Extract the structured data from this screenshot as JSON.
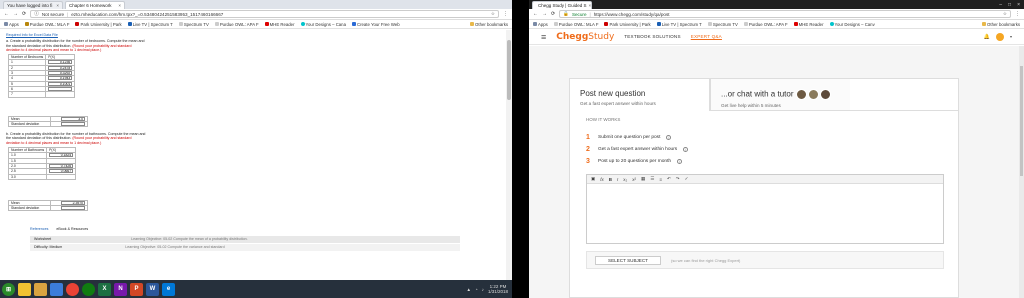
{
  "left_window": {
    "tabs": [
      {
        "label": "You have logged into fi",
        "active": false
      },
      {
        "label": "Chapter 6 Homework",
        "active": true
      }
    ],
    "address": {
      "security": "Not secure",
      "url": "ezto.mheducation.com/hm.tpx?_=0.53480424251583953_1517460166667"
    },
    "bookmarks": [
      "Apps",
      "Purdue OWL: MLA F",
      "Park University | Park",
      "Live TV | Spectrum T",
      "Spectrum TV",
      "Purdue OWL: APA F",
      "MHE Reader",
      "Your Designs – Cana",
      "Create Your Free Web"
    ],
    "bookmarks_other": "Other bookmarks",
    "content": {
      "top_link": "Required Info for Excel Data File",
      "qa_text": "a. Create a probability distribution for the number of bedrooms. Compute the mean and the standard deviation of this distribution.",
      "qa_red": "(Round your probability and standard deviation to 4 decimal places and mean to 1 decimal place.)",
      "table_a_header": [
        "Number of Bedrooms",
        "P(X)"
      ],
      "table_a_rows": [
        [
          "1",
          "0.1236"
        ],
        [
          "2",
          "0.2478"
        ],
        [
          "3",
          "0.3292"
        ],
        [
          "4",
          "0.1943"
        ],
        [
          "5",
          "0.1001"
        ],
        [
          "6",
          ""
        ],
        [
          "7",
          ""
        ]
      ],
      "mean_label": "Mean",
      "mean_a": "3.0",
      "sd_label": "Standard deviation",
      "sd_a": "",
      "qb_text": "b. Create a probability distribution for the number of bathrooms. Compute the mean and the standard deviation of this distribution.",
      "qb_red": "(Round your probability and standard deviation to 4 decimal places and mean to 1 decimal place.)",
      "table_b_header": [
        "Number of Bathrooms",
        "P(X)"
      ],
      "table_b_rows": [
        [
          "1.0",
          "0.1824"
        ],
        [
          "1.5",
          ""
        ],
        [
          "2.0",
          "0.7426"
        ],
        [
          "2.5",
          "0.0667"
        ],
        [
          "3.0",
          ""
        ]
      ],
      "mean_b": "2.3970",
      "sd_b": "",
      "refs_label": "References",
      "refs_value": "eBook & Resources",
      "rows": [
        {
          "label": "Worksheet",
          "value": "Learning Objective: 05-02 Compute the mean of a probability distribution."
        },
        {
          "label": "Difficulty: Medium",
          "value": "Learning Objective: 05-02 Compute the variance and standard"
        }
      ]
    }
  },
  "taskbar": {
    "apps": [
      "start",
      "explorer",
      "folder",
      "store",
      "chrome",
      "xbox",
      "excel",
      "onenote",
      "powerpoint",
      "word",
      "edge"
    ],
    "time": "1:22 PM",
    "date": "1/31/2018"
  },
  "right_window": {
    "tabs": [
      {
        "label": "Chegg Study | Guided S",
        "active": true
      }
    ],
    "address": {
      "security": "Secure",
      "url": "https://www.chegg.com/study/qa/post"
    },
    "bookmarks": [
      "Apps",
      "Purdue OWL: MLA F",
      "Park University | Park",
      "Live TV | Spectrum T",
      "Spectrum TV",
      "Purdue OWL: APA F",
      "MHE Reader",
      "Your Designs – Canv"
    ],
    "bookmarks_other": "Other bookmarks",
    "logo_chegg": "Chegg",
    "logo_study": "Study",
    "nav": [
      {
        "label": "TEXTBOOK SOLUTIONS",
        "active": false
      },
      {
        "label": "EXPERT Q&A",
        "active": true
      }
    ],
    "post_title": "Post new question",
    "post_sub": "Get a fast expert answer within hours",
    "tutor_title": "...or chat with a tutor",
    "tutor_sub": "Get live help within 5 minutes",
    "how_it_works": "HOW IT WORKS",
    "steps": [
      {
        "num": "1",
        "text": "Submit one question per post"
      },
      {
        "num": "2",
        "text": "Get a fast expert answer within hours"
      },
      {
        "num": "3",
        "text": "Post up to 20 questions per month"
      }
    ],
    "select_subject": "SELECT SUBJECT",
    "select_hint": "(so we can find the right Chegg Expert)",
    "accent": "#ef6c1b"
  }
}
